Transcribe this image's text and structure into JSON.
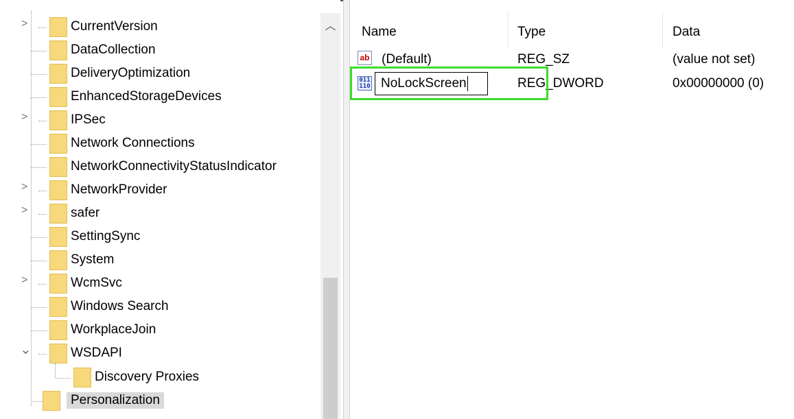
{
  "tree": {
    "items": [
      {
        "label": "CurrentVersion",
        "expander": "›",
        "indent": 0
      },
      {
        "label": "DataCollection",
        "expander": "",
        "indent": 0
      },
      {
        "label": "DeliveryOptimization",
        "expander": "",
        "indent": 0
      },
      {
        "label": "EnhancedStorageDevices",
        "expander": "",
        "indent": 0
      },
      {
        "label": "IPSec",
        "expander": "›",
        "indent": 0
      },
      {
        "label": "Network Connections",
        "expander": "",
        "indent": 0
      },
      {
        "label": "NetworkConnectivityStatusIndicator",
        "expander": "",
        "indent": 0
      },
      {
        "label": "NetworkProvider",
        "expander": "›",
        "indent": 0
      },
      {
        "label": "safer",
        "expander": "›",
        "indent": 0
      },
      {
        "label": "SettingSync",
        "expander": "",
        "indent": 0
      },
      {
        "label": "System",
        "expander": "",
        "indent": 0
      },
      {
        "label": "WcmSvc",
        "expander": "›",
        "indent": 0
      },
      {
        "label": "Windows Search",
        "expander": "",
        "indent": 0
      },
      {
        "label": "WorkplaceJoin",
        "expander": "",
        "indent": 0
      },
      {
        "label": "WSDAPI",
        "expander": "⌄",
        "indent": 0
      },
      {
        "label": "Discovery Proxies",
        "expander": "",
        "indent": 1
      },
      {
        "label": "Personalization",
        "expander": "",
        "indent": 0,
        "selected": true
      }
    ]
  },
  "list": {
    "headers": {
      "name": "Name",
      "type": "Type",
      "data": "Data"
    },
    "rows": [
      {
        "icon": "string-value-icon",
        "name": "(Default)",
        "type": "REG_SZ",
        "data": "(value not set)"
      },
      {
        "icon": "binary-value-icon",
        "name": "NoLockScreen",
        "type": "REG_DWORD",
        "data": "0x00000000 (0)"
      }
    ],
    "rename_value": "NoLockScreen"
  },
  "icons": {
    "folder": "folder-icon",
    "string_value": "ab-string-icon",
    "dword_value": "dword-binary-icon",
    "scroll_up": "chevron-up-icon"
  },
  "colors": {
    "folder": "#f7d87a",
    "highlight": "#3cdc2c",
    "selection": "#d9d9d9",
    "scrollbar_track": "#f0f0f0",
    "scrollbar_thumb": "#cdcdcd"
  }
}
